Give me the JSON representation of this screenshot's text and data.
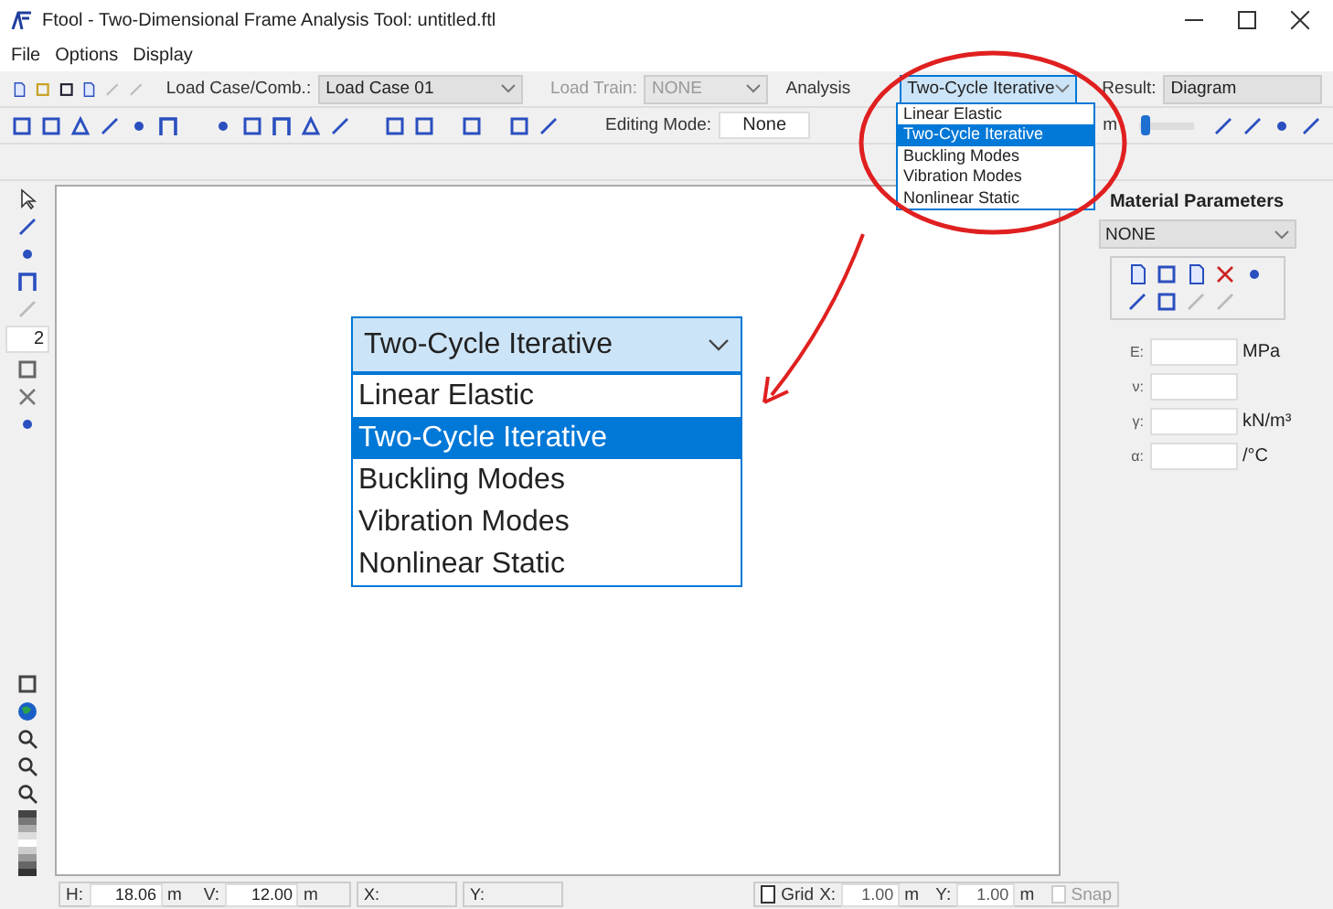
{
  "window": {
    "title": "Ftool - Two-Dimensional Frame Analysis Tool: untitled.ftl"
  },
  "menu": [
    "File",
    "Options",
    "Display"
  ],
  "toolbar": {
    "load_case": {
      "label": "Load Case/Comb.:",
      "value": "Load Case 01"
    },
    "load_train": {
      "label": "Load Train:",
      "value": "NONE",
      "disabled": true
    },
    "analysis": {
      "label": "Analysis",
      "value": "Two-Cycle Iterative",
      "expanded": true,
      "options": [
        {
          "label": "Linear Elastic",
          "selected": false
        },
        {
          "label": "Two-Cycle Iterative",
          "selected": true
        },
        {
          "label": "Buckling Modes",
          "selected": false
        },
        {
          "label": "Vibration Modes",
          "selected": false
        },
        {
          "label": "Nonlinear Static",
          "selected": false
        }
      ]
    },
    "result": {
      "label": "Result:",
      "value": "Diagram"
    },
    "editing_mode": {
      "label": "Editing Mode:",
      "value": "None"
    },
    "unit": "m",
    "slider": {
      "level": 0.03
    }
  },
  "left_tools": {
    "line_number": "2"
  },
  "zoomed_dropdown": {
    "value": "Two-Cycle Iterative",
    "options": [
      {
        "label": "Linear Elastic",
        "selected": false
      },
      {
        "label": "Two-Cycle Iterative",
        "selected": true
      },
      {
        "label": "Buckling Modes",
        "selected": false
      },
      {
        "label": "Vibration Modes",
        "selected": false
      },
      {
        "label": "Nonlinear Static",
        "selected": false
      }
    ]
  },
  "material": {
    "title": "Material Parameters",
    "preset": "NONE",
    "fields": [
      {
        "label": "E:",
        "unit": "MPa"
      },
      {
        "label": "ν:"
      },
      {
        "label": "γ:",
        "unit": "kN/m³"
      },
      {
        "label": "α:",
        "unit": "/°C"
      }
    ]
  },
  "status": {
    "h": {
      "label": "H:",
      "value": "18.06",
      "unit": "m"
    },
    "v": {
      "label": "V:",
      "value": "12.00",
      "unit": "m"
    },
    "x": {
      "label": "X:"
    },
    "y": {
      "label": "Y:"
    },
    "grid": {
      "label": "Grid",
      "checked": false
    },
    "grid_x": {
      "label": "X:",
      "value": "1.00",
      "unit": "m"
    },
    "grid_y": {
      "label": "Y:",
      "value": "1.00",
      "unit": "m"
    },
    "snap": {
      "label": "Snap",
      "checked": false,
      "disabled": true
    }
  }
}
